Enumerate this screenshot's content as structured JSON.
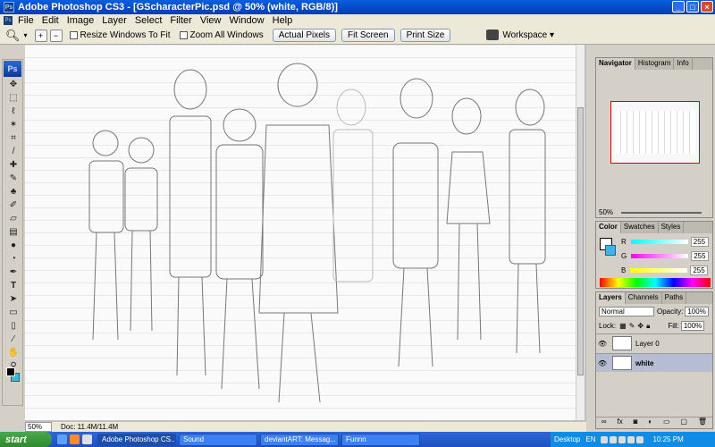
{
  "window": {
    "title": "Adobe Photoshop CS3 - [GScharacterPic.psd @ 50% (white, RGB/8)]",
    "app_icon": "Ps",
    "controls": [
      "minimize",
      "maximize",
      "close"
    ]
  },
  "menu": [
    "File",
    "Edit",
    "Image",
    "Layer",
    "Select",
    "Filter",
    "View",
    "Window",
    "Help"
  ],
  "options_bar": {
    "resize_windows_label": "Resize Windows To Fit",
    "zoom_all_label": "Zoom All Windows",
    "actual_pixels": "Actual Pixels",
    "fit_screen": "Fit Screen",
    "print_size": "Print Size",
    "workspace": "Workspace ▾"
  },
  "toolbox": {
    "logo": "Ps",
    "tools": [
      "move-icon",
      "marquee-icon",
      "lasso-icon",
      "magic-wand-icon",
      "crop-icon",
      "slice-icon",
      "healing-brush-icon",
      "brush-icon",
      "clone-stamp-icon",
      "history-brush-icon",
      "eraser-icon",
      "gradient-icon",
      "blur-icon",
      "dodge-icon",
      "pen-icon",
      "type-icon",
      "path-select-icon",
      "shape-icon",
      "notes-icon",
      "eyedropper-icon",
      "hand-icon",
      "zoom-icon"
    ],
    "foreground_color": "#000000",
    "background_color": "#3cb6ea"
  },
  "status": {
    "zoom": "50%",
    "doc": "Doc: 11.4M/11.4M"
  },
  "navigator": {
    "tabs": [
      "Navigator",
      "Histogram",
      "Info"
    ],
    "zoom": "50%"
  },
  "color_panel": {
    "tabs": [
      "Color",
      "Swatches",
      "Styles"
    ],
    "channels": [
      {
        "name": "R",
        "value": "255",
        "color": "#22c0d0"
      },
      {
        "name": "G",
        "value": "255",
        "color": "#d030d0"
      },
      {
        "name": "B",
        "value": "255",
        "color": "#e0e020"
      }
    ]
  },
  "layers_panel": {
    "tabs": [
      "Layers",
      "Channels",
      "Paths"
    ],
    "blend_mode": "Normal",
    "opacity_label": "Opacity:",
    "opacity": "100%",
    "lock_label": "Lock:",
    "fill_label": "Fill:",
    "fill": "100%",
    "layers": [
      {
        "name": "Layer 0",
        "selected": false
      },
      {
        "name": "white",
        "selected": true
      }
    ]
  },
  "taskbar": {
    "start": "start",
    "buttons": [
      "Adobe Photoshop CS...",
      "Sound",
      "deviantART: Messag...",
      "Funnn"
    ],
    "desktop": "Desktop",
    "lang": "EN",
    "clock": "10:25 PM"
  }
}
